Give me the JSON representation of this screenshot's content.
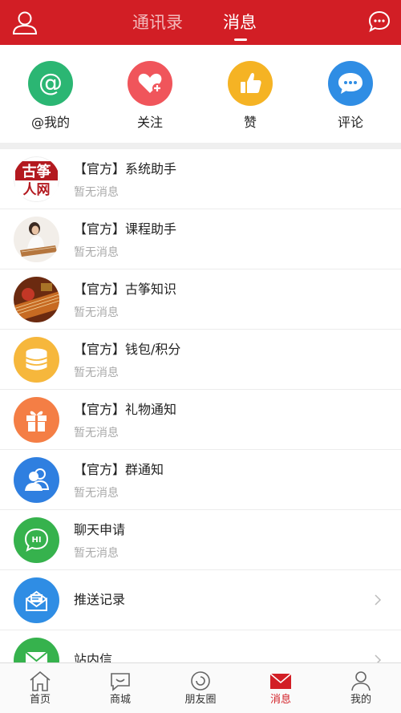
{
  "header": {
    "tabs": [
      {
        "label": "通讯录",
        "active": false
      },
      {
        "label": "消息",
        "active": true
      }
    ],
    "left_icon": "user-icon",
    "right_icon": "chat-bubble-icon",
    "bar_color": "#d21e25"
  },
  "quick_actions": [
    {
      "label": "@我的",
      "icon": "at-icon",
      "color": "#2bb673"
    },
    {
      "label": "关注",
      "icon": "heart-plus-icon",
      "color": "#f0555b"
    },
    {
      "label": "赞",
      "icon": "thumbs-up-icon",
      "color": "#f5b324"
    },
    {
      "label": "评论",
      "icon": "comment-icon",
      "color": "#2f8de4"
    }
  ],
  "conversations": [
    {
      "title": "【官方】系统助手",
      "subtitle": "暂无消息",
      "avatar": "guzheng-logo",
      "logo_text": "古筝人网"
    },
    {
      "title": "【官方】课程助手",
      "subtitle": "暂无消息",
      "avatar": "woman-playing-guzheng-photo"
    },
    {
      "title": "【官方】古筝知识",
      "subtitle": "暂无消息",
      "avatar": "guzheng-closeup-photo"
    },
    {
      "title": "【官方】钱包/积分",
      "subtitle": "暂无消息",
      "avatar": "coins-icon"
    },
    {
      "title": "【官方】礼物通知",
      "subtitle": "暂无消息",
      "avatar": "gift-icon"
    },
    {
      "title": "【官方】群通知",
      "subtitle": "暂无消息",
      "avatar": "group-icon"
    },
    {
      "title": "聊天申请",
      "subtitle": "暂无消息",
      "avatar": "hi-chat-icon"
    }
  ],
  "menu_rows": [
    {
      "title": "推送记录",
      "icon": "push-mail-icon"
    },
    {
      "title": "站内信",
      "icon": "envelope-icon"
    }
  ],
  "tabbar": [
    {
      "label": "首页",
      "icon": "home-icon",
      "active": false
    },
    {
      "label": "商城",
      "icon": "shop-icon",
      "active": false
    },
    {
      "label": "朋友圈",
      "icon": "moments-icon",
      "active": false
    },
    {
      "label": "消息",
      "icon": "mail-icon",
      "active": true
    },
    {
      "label": "我的",
      "icon": "profile-icon",
      "active": false
    }
  ]
}
